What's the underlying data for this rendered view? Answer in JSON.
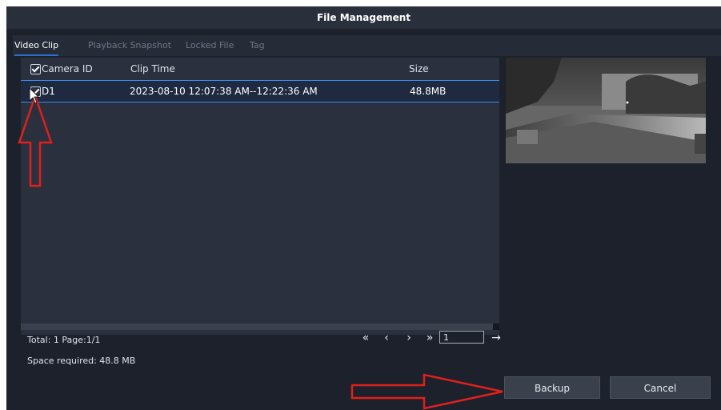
{
  "window": {
    "title": "File Management"
  },
  "tabs": [
    {
      "label": "Video Clip",
      "active": true
    },
    {
      "label": "Playback Snapshot",
      "active": false
    },
    {
      "label": "Locked File",
      "active": false
    },
    {
      "label": "Tag",
      "active": false
    }
  ],
  "table": {
    "headers": [
      "Camera ID",
      "Clip Time",
      "Size"
    ],
    "header_checked": true,
    "rows": [
      {
        "checked": true,
        "camera_id": "D1",
        "clip_time": "2023-08-10 12:07:38 AM--12:22:36 AM",
        "size": "48.8MB"
      }
    ]
  },
  "footer": {
    "total": "Total: 1  Page:1/1",
    "space_required": "Space required: 48.8 MB"
  },
  "pager": {
    "first_icon": "double-chevron-left",
    "prev_icon": "chevron-left",
    "next_icon": "chevron-right",
    "last_icon": "double-chevron-right",
    "page_input": "1",
    "go_icon": "arrow-right"
  },
  "buttons": {
    "backup": "Backup",
    "cancel": "Cancel"
  },
  "colors": {
    "accent": "#3b8be8",
    "annotation_arrow": "#e0201c"
  }
}
